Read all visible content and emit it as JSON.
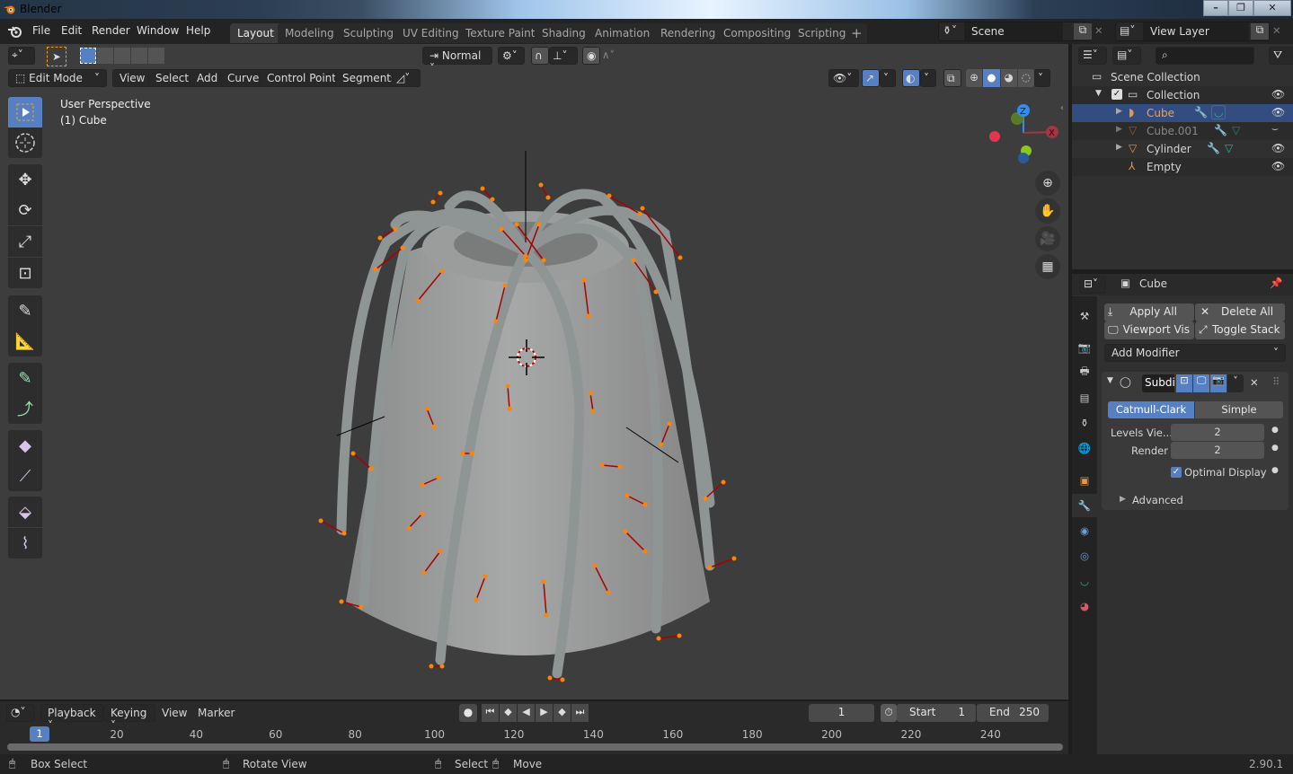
{
  "window": {
    "title": "Blender",
    "controls": [
      "minimize",
      "maximize",
      "close"
    ]
  },
  "menubar": {
    "items": [
      "File",
      "Edit",
      "Render",
      "Window",
      "Help"
    ]
  },
  "workspaces": {
    "tabs": [
      "Layout",
      "Modeling",
      "Sculpting",
      "UV Editing",
      "Texture Paint",
      "Shading",
      "Animation",
      "Rendering",
      "Compositing",
      "Scripting"
    ],
    "active": "Layout",
    "add_label": "+"
  },
  "scene": {
    "label": "Scene",
    "view_layer": "View Layer"
  },
  "viewport_header": {
    "transform_orientation": "Normal",
    "mode": "Edit Mode",
    "menus": [
      "View",
      "Select",
      "Add",
      "Curve",
      "Control Points",
      "Segments"
    ]
  },
  "viewport": {
    "perspective": "User Perspective",
    "object_info": "(1) Cube",
    "gizmo_axes": [
      "Z",
      "Y",
      "X"
    ],
    "colors": {
      "x_axis": "#e0384e",
      "y_axis": "#8bc71c",
      "z_axis": "#2f8ef5",
      "accent": "#5680c2",
      "control_point": "#ff8500"
    }
  },
  "outliner": {
    "search_placeholder": "",
    "root": "Scene Collection",
    "collection": "Collection",
    "items": [
      {
        "name": "Cube",
        "type": "curve",
        "selected": true,
        "visible": true
      },
      {
        "name": "Cube.001",
        "type": "mesh",
        "selected": false,
        "visible": false
      },
      {
        "name": "Cylinder",
        "type": "mesh",
        "selected": false,
        "visible": true
      },
      {
        "name": "Empty",
        "type": "empty",
        "selected": false,
        "visible": true
      }
    ]
  },
  "properties": {
    "object_name": "Cube",
    "buttons": {
      "apply_all": "Apply All",
      "delete_all": "Delete All",
      "viewport_vis": "Viewport Vis",
      "toggle_stack": "Toggle Stack"
    },
    "add_modifier": "Add Modifier",
    "modifier": {
      "name": "Subdi",
      "type_options": [
        "Catmull-Clark",
        "Simple"
      ],
      "active_type": "Catmull-Clark",
      "levels_viewport_label": "Levels Vie...",
      "levels_viewport": "2",
      "render_label": "Render",
      "render": "2",
      "optimal_display_label": "Optimal Display",
      "optimal_display": true,
      "advanced_label": "Advanced"
    },
    "tabs": [
      "tool",
      "render",
      "output",
      "view-layer",
      "scene",
      "world",
      "object",
      "modifiers",
      "particles",
      "physics",
      "object-data",
      "material"
    ]
  },
  "timeline": {
    "menus": [
      "Playback",
      "Keying",
      "View",
      "Marker"
    ],
    "current_frame": "1",
    "start_label": "Start",
    "start": "1",
    "end_label": "End",
    "end": "250",
    "ruler_ticks": [
      "20",
      "40",
      "60",
      "80",
      "100",
      "120",
      "140",
      "160",
      "180",
      "200",
      "220",
      "240"
    ],
    "playhead": "1"
  },
  "statusbar": {
    "hints": [
      "Box Select",
      "Rotate View",
      "Select",
      "Move"
    ],
    "version": "2.90.1"
  }
}
